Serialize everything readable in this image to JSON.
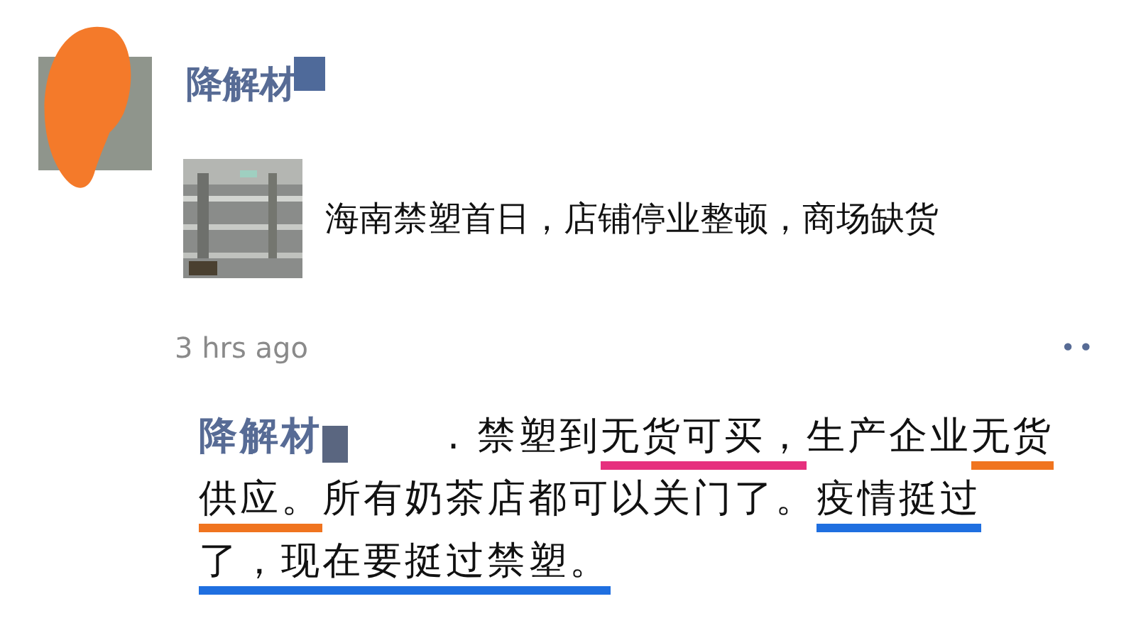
{
  "post": {
    "author": "降解材",
    "link": {
      "title": "海南禁塑首日，店铺停业整顿，商场缺货"
    },
    "time": "3 hrs ago",
    "more": "••"
  },
  "comments": [
    {
      "author": "降解材",
      "segments": [
        {
          "text": ". 禁塑到"
        },
        {
          "text": "无货可买，",
          "color": "#e6307e"
        },
        {
          "text": "生产企业"
        },
        {
          "text": "无货供应。",
          "color": "#f0741f"
        },
        {
          "text": "所有奶茶店都可以关门了。"
        },
        {
          "text": "疫情挺过了，现在要挺过禁塑。",
          "color": "#1f6fe0"
        }
      ]
    }
  ]
}
